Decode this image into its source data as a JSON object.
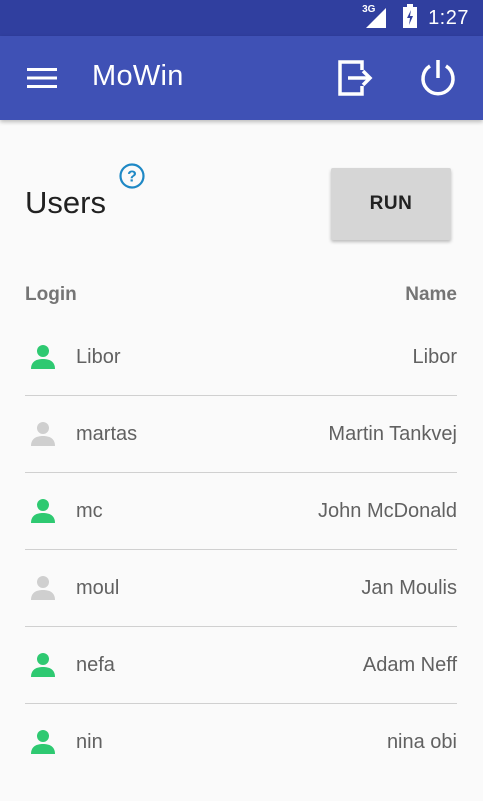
{
  "statusbar": {
    "network": "3G",
    "time": "1:27"
  },
  "appbar": {
    "title": "MoWin",
    "menu_icon": "menu-icon",
    "logout_icon": "logout-icon",
    "power_icon": "power-icon"
  },
  "section": {
    "title": "Users",
    "help_icon": "help-icon",
    "run_label": "RUN"
  },
  "table": {
    "headers": {
      "login": "Login",
      "name": "Name"
    },
    "rows": [
      {
        "login": "Libor",
        "name": "Libor",
        "active": true
      },
      {
        "login": "martas",
        "name": "Martin Tankvej",
        "active": false
      },
      {
        "login": "mc",
        "name": "John McDonald",
        "active": true
      },
      {
        "login": "moul",
        "name": "Jan Moulis",
        "active": false
      },
      {
        "login": "nefa",
        "name": "Adam Neff",
        "active": true
      },
      {
        "login": "nin",
        "name": "nina obi",
        "active": true
      }
    ]
  },
  "colors": {
    "primary": "#3f51b5",
    "primary_dark": "#303f9f",
    "active_user": "#2ec971",
    "inactive_user": "#cfcfcf",
    "help": "#1e88c5"
  }
}
